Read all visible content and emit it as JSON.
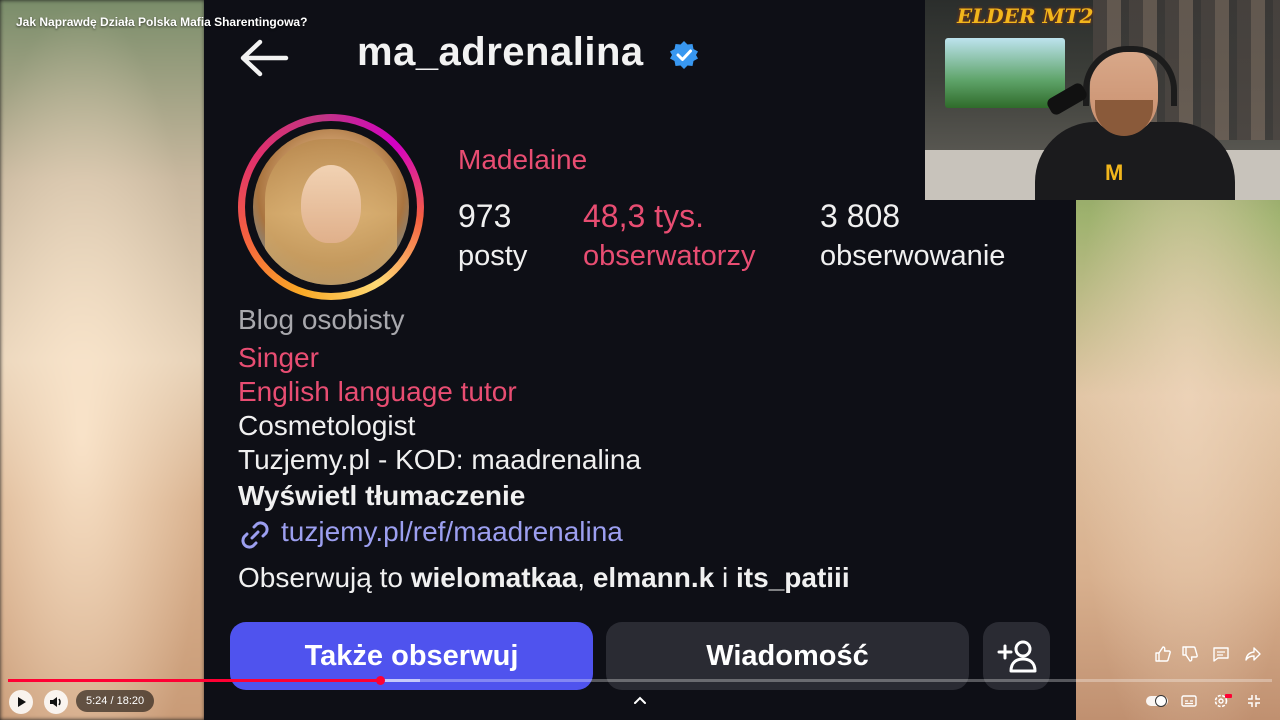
{
  "video": {
    "title": "Jak Naprawdę Działa Polska Mafia Sharentingowa?",
    "current_time": "5:24",
    "duration": "18:20",
    "time_display": "5:24 / 18:20",
    "progress_fraction": 0.294
  },
  "profile": {
    "username": "ma_adrenalina",
    "display_name": "Madelaine",
    "stats": [
      {
        "value": "973",
        "label": "posty"
      },
      {
        "value": "48,3 tys.",
        "label": "obserwatorzy"
      },
      {
        "value": "3 808",
        "label": "obserwowanie"
      }
    ],
    "category": "Blog osobisty",
    "bio": [
      "Singer",
      "English language tutor",
      "Cosmetologist",
      "Tuzjemy.pl - KOD: maadrenalina"
    ],
    "translate_label": "Wyświetl tłumaczenie",
    "link": "tuzjemy.pl/ref/maadrenalina",
    "followed_by_prefix": "Obserwują to",
    "followed_by_user1": "wielomatkaa",
    "followed_by_sep1": ",",
    "followed_by_user2": "elmann.k",
    "followed_by_sep2": "i",
    "followed_by_user3": "its_patiii",
    "buttons": {
      "follow": "Także obserwuj",
      "message": "Wiadomość"
    }
  },
  "webcam": {
    "brand_text": "ELDER MT2"
  },
  "colors": {
    "accent_pink": "#e84d72",
    "follow_button": "#4f53ee",
    "link": "#9c9ff0",
    "progress": "#ff0033",
    "verified": "#3897f0"
  },
  "icons": [
    "back-arrow-icon",
    "verified-badge-icon",
    "link-icon",
    "add-person-icon",
    "play-icon",
    "volume-icon",
    "like-icon",
    "dislike-icon",
    "comment-icon",
    "share-icon",
    "autoplay-toggle-icon",
    "subtitles-icon",
    "settings-icon",
    "exit-fullscreen-icon",
    "chevron-up-icon"
  ]
}
